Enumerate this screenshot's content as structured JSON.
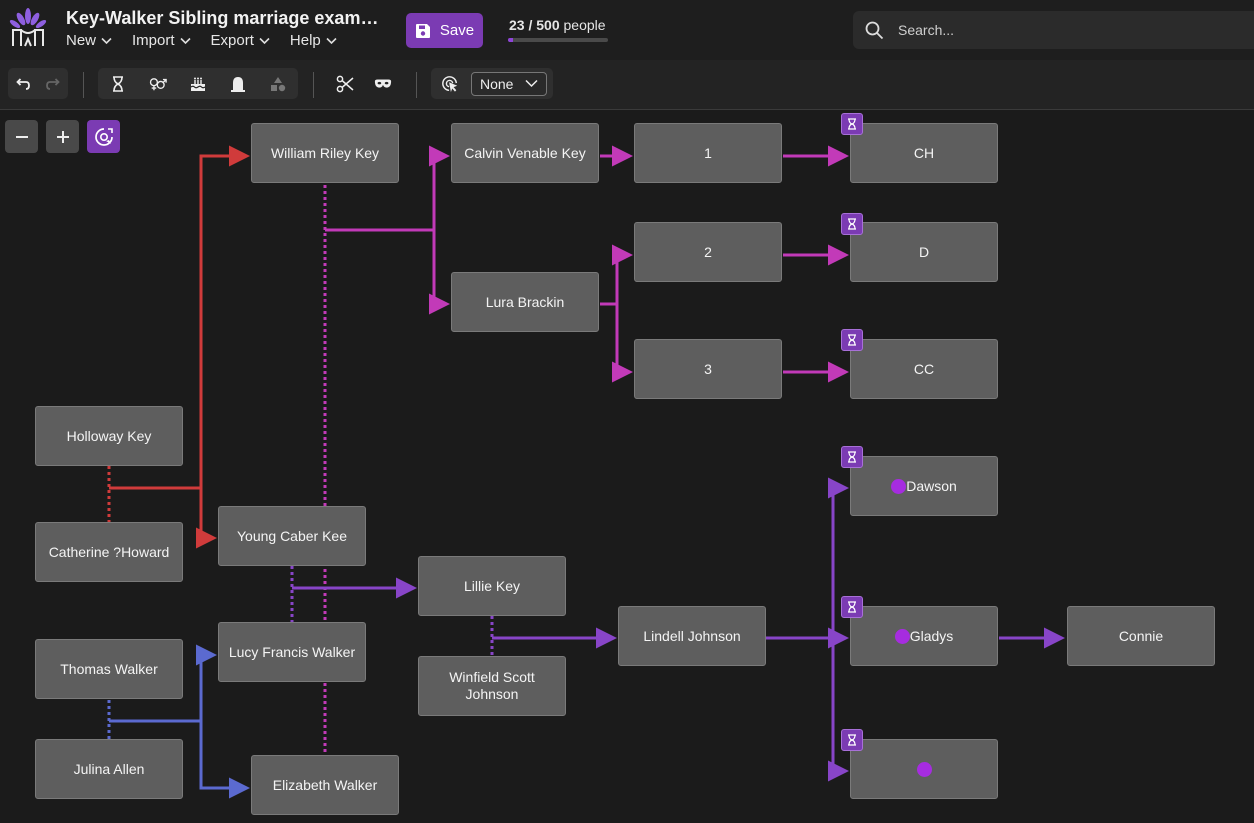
{
  "header": {
    "title": "Key-Walker Sibling marriage exam…",
    "menus": [
      "New",
      "Import",
      "Export",
      "Help"
    ],
    "save_label": "Save",
    "people_count": "23 / 500",
    "people_label": " people",
    "people_fraction": 0.046,
    "search_placeholder": "Search..."
  },
  "toolbar": {
    "select_value": "None"
  },
  "colors": {
    "accent": "#7b3bb3",
    "red_line": "#d03b3b",
    "magenta_line": "#c23ab8",
    "purple_line": "#8845c8",
    "blue_line": "#5b6ad0"
  },
  "nodes": [
    {
      "id": "william",
      "label": "William Riley Key"
    },
    {
      "id": "calvin",
      "label": "Calvin Venable Key"
    },
    {
      "id": "n1",
      "label": "1"
    },
    {
      "id": "ch",
      "label": "CH"
    },
    {
      "id": "n2",
      "label": "2"
    },
    {
      "id": "d",
      "label": "D"
    },
    {
      "id": "lura",
      "label": "Lura Brackin"
    },
    {
      "id": "n3",
      "label": "3"
    },
    {
      "id": "cc",
      "label": "CC"
    },
    {
      "id": "holloway",
      "label": "Holloway Key"
    },
    {
      "id": "dawson",
      "label": "Dawson"
    },
    {
      "id": "catherine",
      "label": "Catherine ?Howard"
    },
    {
      "id": "young",
      "label": "Young Caber Kee"
    },
    {
      "id": "lillie",
      "label": "Lillie Key"
    },
    {
      "id": "lindell",
      "label": "Lindell Johnson"
    },
    {
      "id": "gladys",
      "label": "Gladys"
    },
    {
      "id": "connie",
      "label": "Connie"
    },
    {
      "id": "thomas",
      "label": "Thomas Walker"
    },
    {
      "id": "lucy",
      "label": "Lucy Francis Walker"
    },
    {
      "id": "winfield",
      "label": "Winfield Scott Johnson"
    },
    {
      "id": "julina",
      "label": "Julina Allen"
    },
    {
      "id": "elizabeth",
      "label": "Elizabeth Walker"
    },
    {
      "id": "unnamed",
      "label": ""
    }
  ]
}
